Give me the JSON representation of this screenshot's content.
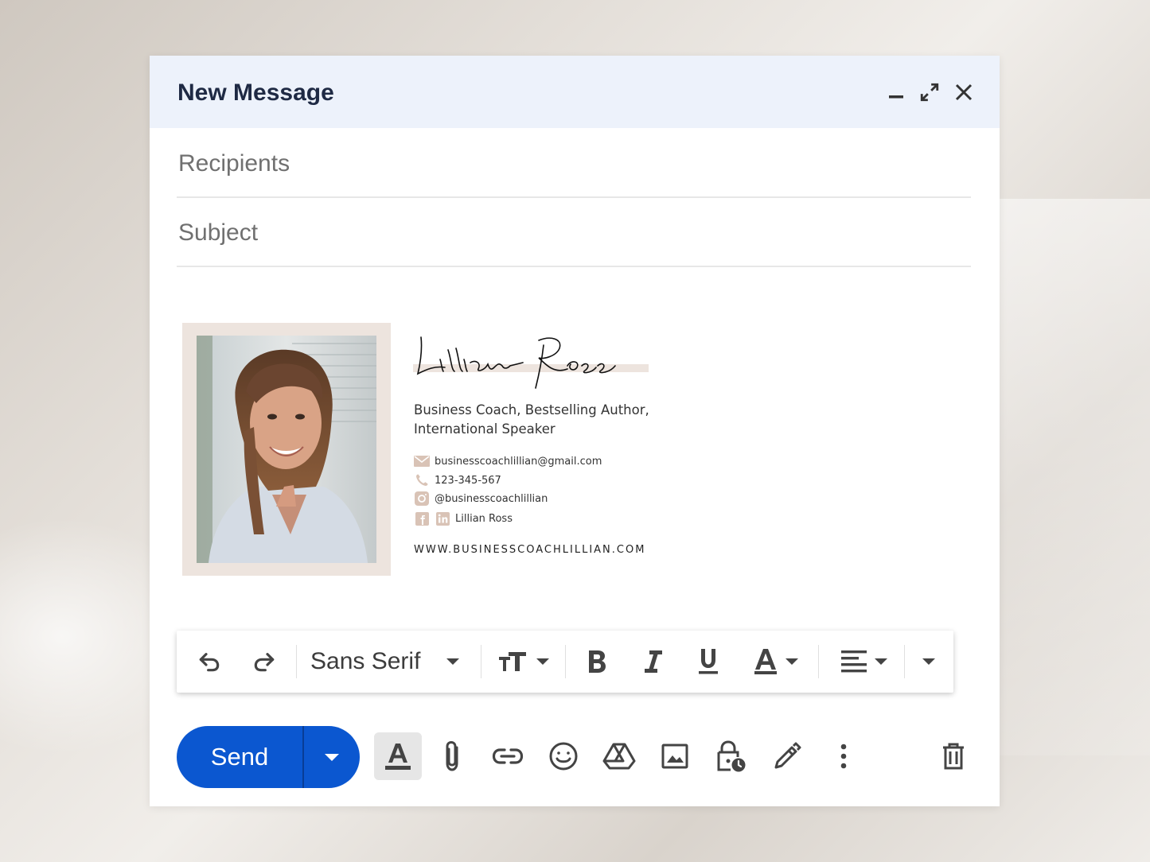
{
  "window": {
    "title": "New Message"
  },
  "fields": {
    "recipients_placeholder": "Recipients",
    "subject_placeholder": "Subject"
  },
  "signature": {
    "name": "Lillian Ross",
    "title_line1": "Business Coach, Bestselling Author,",
    "title_line2": "International Speaker",
    "email": "businesscoachlillian@gmail.com",
    "phone": "123-345-567",
    "instagram": "@businesscoachlillian",
    "social_name": "Lillian Ross",
    "website": "WWW.BUSINESSCOACHLILLIAN.COM",
    "accent_color": "#d9c3b6",
    "frame_color": "#ede4de"
  },
  "toolbar": {
    "font": "Sans Serif"
  },
  "actions": {
    "send_label": "Send",
    "send_color": "#0b57d0"
  },
  "icons": [
    "minimize-icon",
    "expand-icon",
    "close-icon",
    "undo-icon",
    "redo-icon",
    "text-size-icon",
    "bold-icon",
    "italic-icon",
    "underline-icon",
    "text-color-icon",
    "align-icon",
    "more-formatting-icon",
    "formatting-options-icon",
    "attach-icon",
    "link-icon",
    "emoji-icon",
    "drive-icon",
    "photo-icon",
    "confidential-icon",
    "signature-icon",
    "more-options-icon",
    "trash-icon"
  ]
}
